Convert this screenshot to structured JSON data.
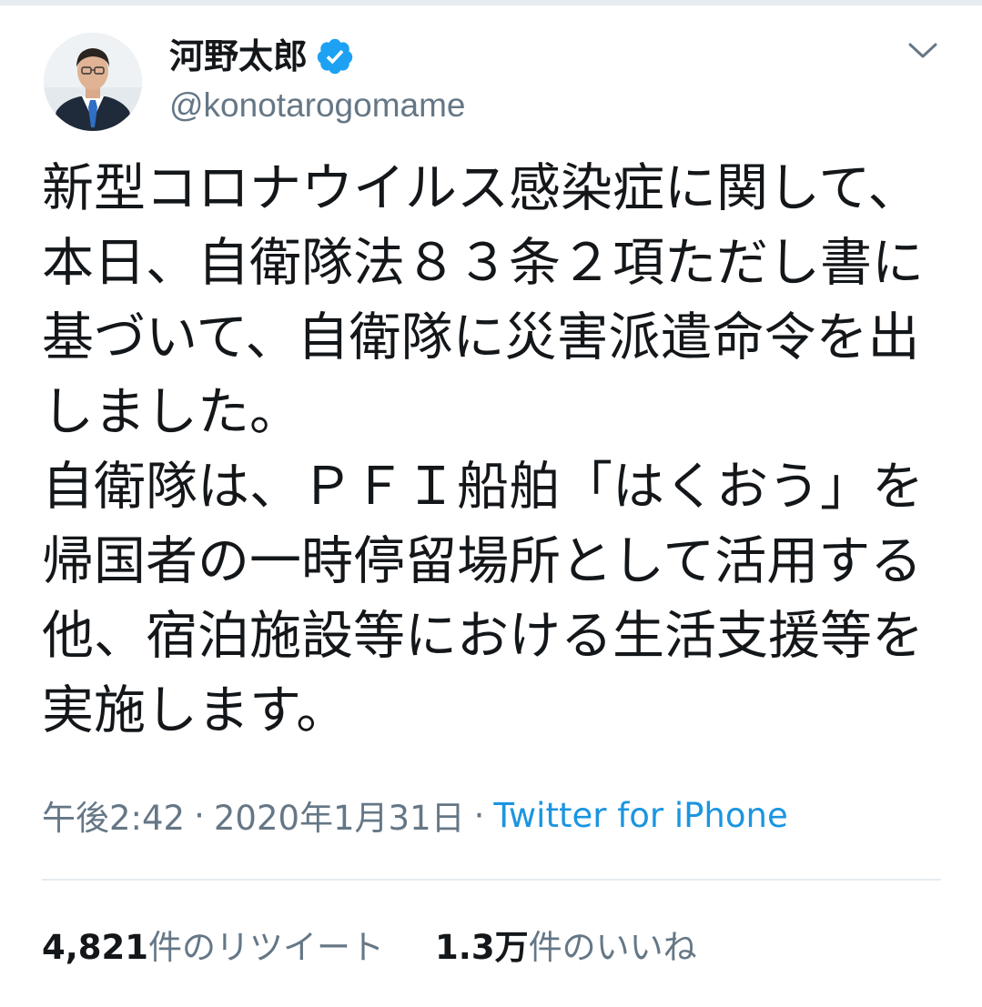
{
  "author": {
    "display_name": "河野太郎",
    "handle": "@konotarogomame",
    "verified": true,
    "verified_icon": "verified-badge-icon",
    "avatar_icon": "profile-photo"
  },
  "menu": {
    "icon": "chevron-down-icon"
  },
  "tweet": {
    "text": "新型コロナウイルス感染症に関して、本日、自衛隊法８３条２項ただし書に基づいて、自衛隊に災害派遣命令を出しました。\n自衛隊は、ＰＦＩ船舶「はくおう」を帰国者の一時停留場所として活用する他、宿泊施設等における生活支援等を実施します。"
  },
  "meta": {
    "time": "午後2:42",
    "separator": "·",
    "date": "2020年1月31日",
    "source": "Twitter for iPhone"
  },
  "stats": {
    "retweets_count": "4,821",
    "retweets_label": "件のリツイート",
    "likes_count": "1.3万",
    "likes_label": "件のいいね"
  },
  "colors": {
    "text": "#14171a",
    "secondary": "#657786",
    "link": "#1b95e0",
    "verified": "#1da1f2",
    "divider": "#e6ecf0"
  }
}
